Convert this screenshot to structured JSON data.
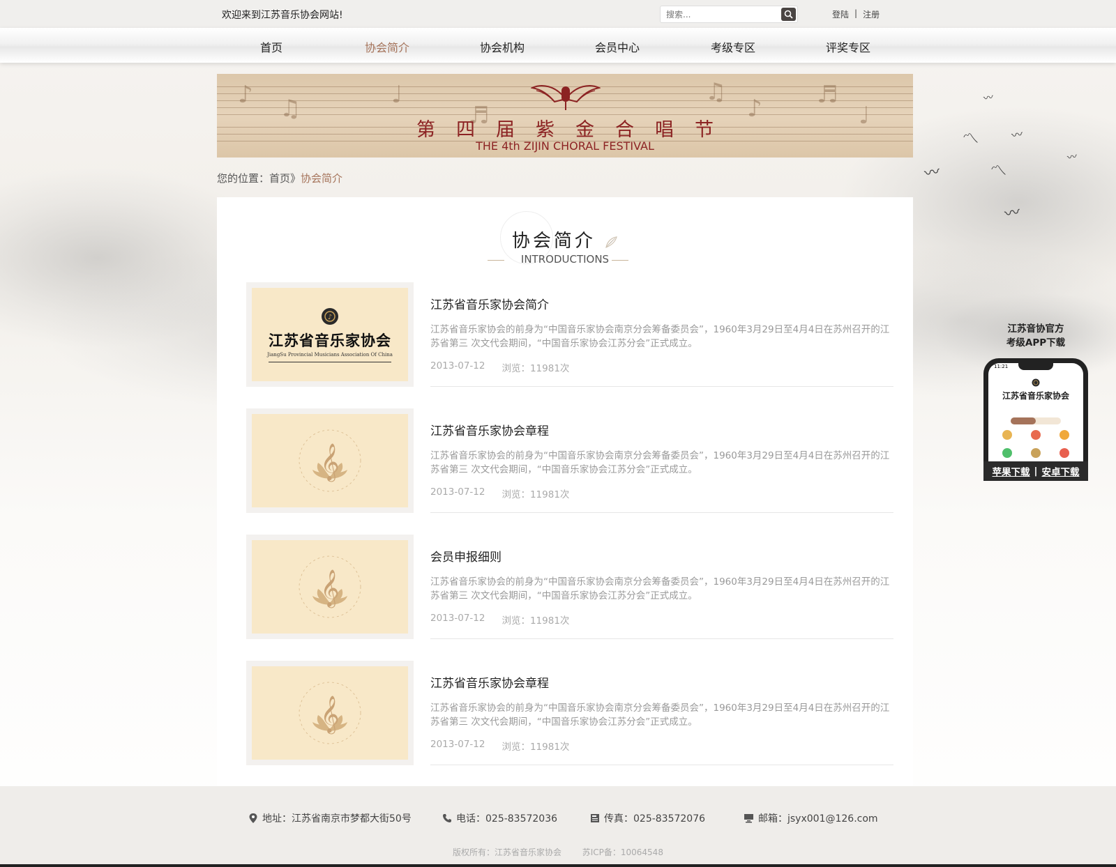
{
  "topbar": {
    "welcome": "欢迎来到江苏音乐协会网站!",
    "search_placeholder": "搜索...",
    "login": "登陆",
    "separator": "|",
    "register": "注册"
  },
  "nav": {
    "items": [
      "首页",
      "协会简介",
      "协会机构",
      "会员中心",
      "考级专区",
      "评奖专区"
    ],
    "active_index": 1,
    "active_color": "#a5735a"
  },
  "banner": {
    "title": "第四届紫金合唱节",
    "subtitle": "THE 4th ZIJIN CHORAL FESTIVAL",
    "title_color": "#8c2323"
  },
  "breadcrumb": {
    "prefix": "您的位置：",
    "home": "首页",
    "sep": "》",
    "current": "协会简介"
  },
  "section": {
    "title": "协会简介",
    "subtitle": "INTRODUCTIONS"
  },
  "articles": [
    {
      "title": "江苏省音乐家协会简介",
      "desc": "江苏省音乐家协会的前身为“中国音乐家协会南京分会筹备委员会”，1960年3月29日至4月4日在苏州召开的江苏省第三 次文代会期间，“中国音乐家协会江苏分会”正式成立。",
      "date": "2013-07-12",
      "views": "浏览：11981次",
      "thumb_logo_text": "江苏省音乐家协会",
      "thumb_logo_sub": "JiangSu Provincial Musicians Association Of China"
    },
    {
      "title": "江苏省音乐家协会章程",
      "desc": "江苏省音乐家协会的前身为“中国音乐家协会南京分会筹备委员会”，1960年3月29日至4月4日在苏州召开的江苏省第三 次文代会期间，“中国音乐家协会江苏分会”正式成立。",
      "date": "2013-07-12",
      "views": "浏览：11981次"
    },
    {
      "title": "会员申报细则",
      "desc": "江苏省音乐家协会的前身为“中国音乐家协会南京分会筹备委员会”，1960年3月29日至4月4日在苏州召开的江苏省第三 次文代会期间，“中国音乐家协会江苏分会”正式成立。",
      "date": "2013-07-12",
      "views": "浏览：11981次"
    },
    {
      "title": "江苏省音乐家协会章程",
      "desc": "江苏省音乐家协会的前身为“中国音乐家协会南京分会筹备委员会”，1960年3月29日至4月4日在苏州召开的江苏省第三 次文代会期间，“中国音乐家协会江苏分会”正式成立。",
      "date": "2013-07-12",
      "views": "浏览：11981次"
    }
  ],
  "app": {
    "title_line1": "江苏音协官方",
    "title_line2": "考级APP下载",
    "phone_time": "11:21",
    "phone_brand": "江苏省音乐家协会",
    "ios": "苹果下载",
    "divider": "|",
    "android": "安卓下载"
  },
  "footer": {
    "address": "地址：江苏省南京市梦都大街50号",
    "phone": "电话：025-83572036",
    "fax": "传真：025-83572076",
    "email": "邮箱：jsyx001@126.com",
    "copyright": "版权所有：江苏省音乐家协会",
    "icp": "苏ICP备：10064548"
  }
}
